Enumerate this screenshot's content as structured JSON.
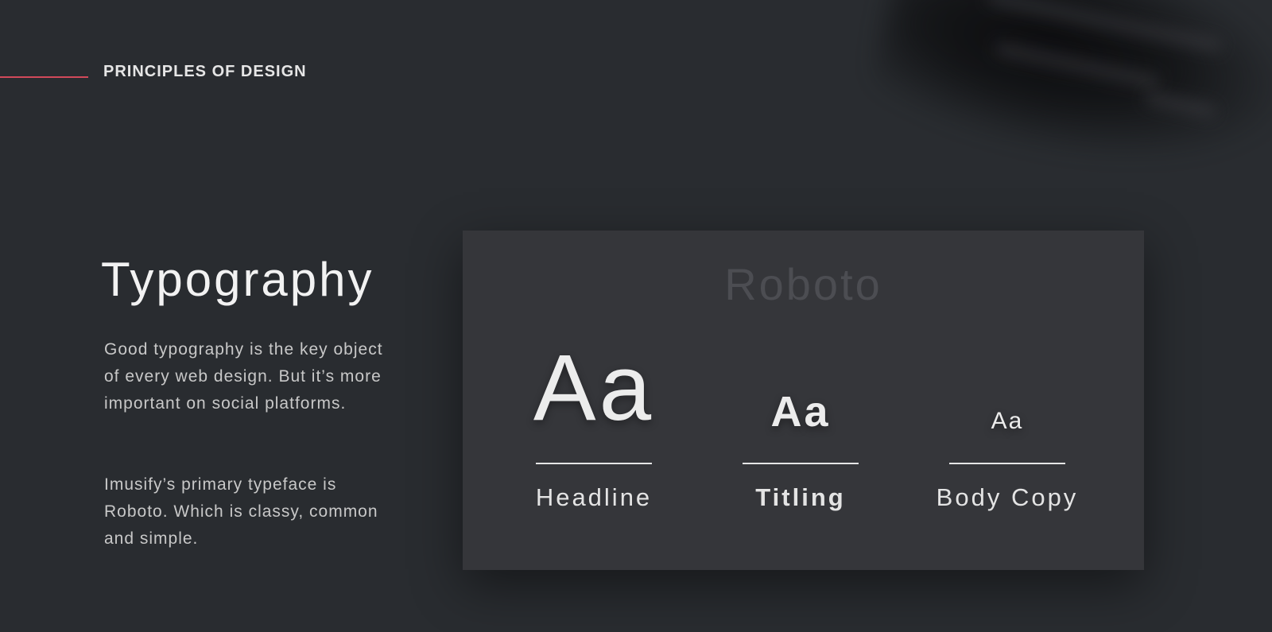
{
  "section": {
    "title": "PRINCIPLES OF DESIGN",
    "accent_color": "#d24a5a"
  },
  "typography": {
    "title": "Typography",
    "paragraphs": [
      "Good typography is the key object of every web design. But it’s more important on social platforms.",
      "Imusify’s primary typeface is Roboto. Which is classy, common and simple."
    ]
  },
  "card": {
    "font_name": "Roboto",
    "specimens": [
      {
        "sample": "Aa",
        "label": "Headline"
      },
      {
        "sample": "Aa",
        "label": "Titling"
      },
      {
        "sample": "Aa",
        "label": "Body Copy"
      }
    ]
  },
  "colors": {
    "background": "#292c30",
    "card": "#35363a",
    "text": "#e6e6e6"
  }
}
